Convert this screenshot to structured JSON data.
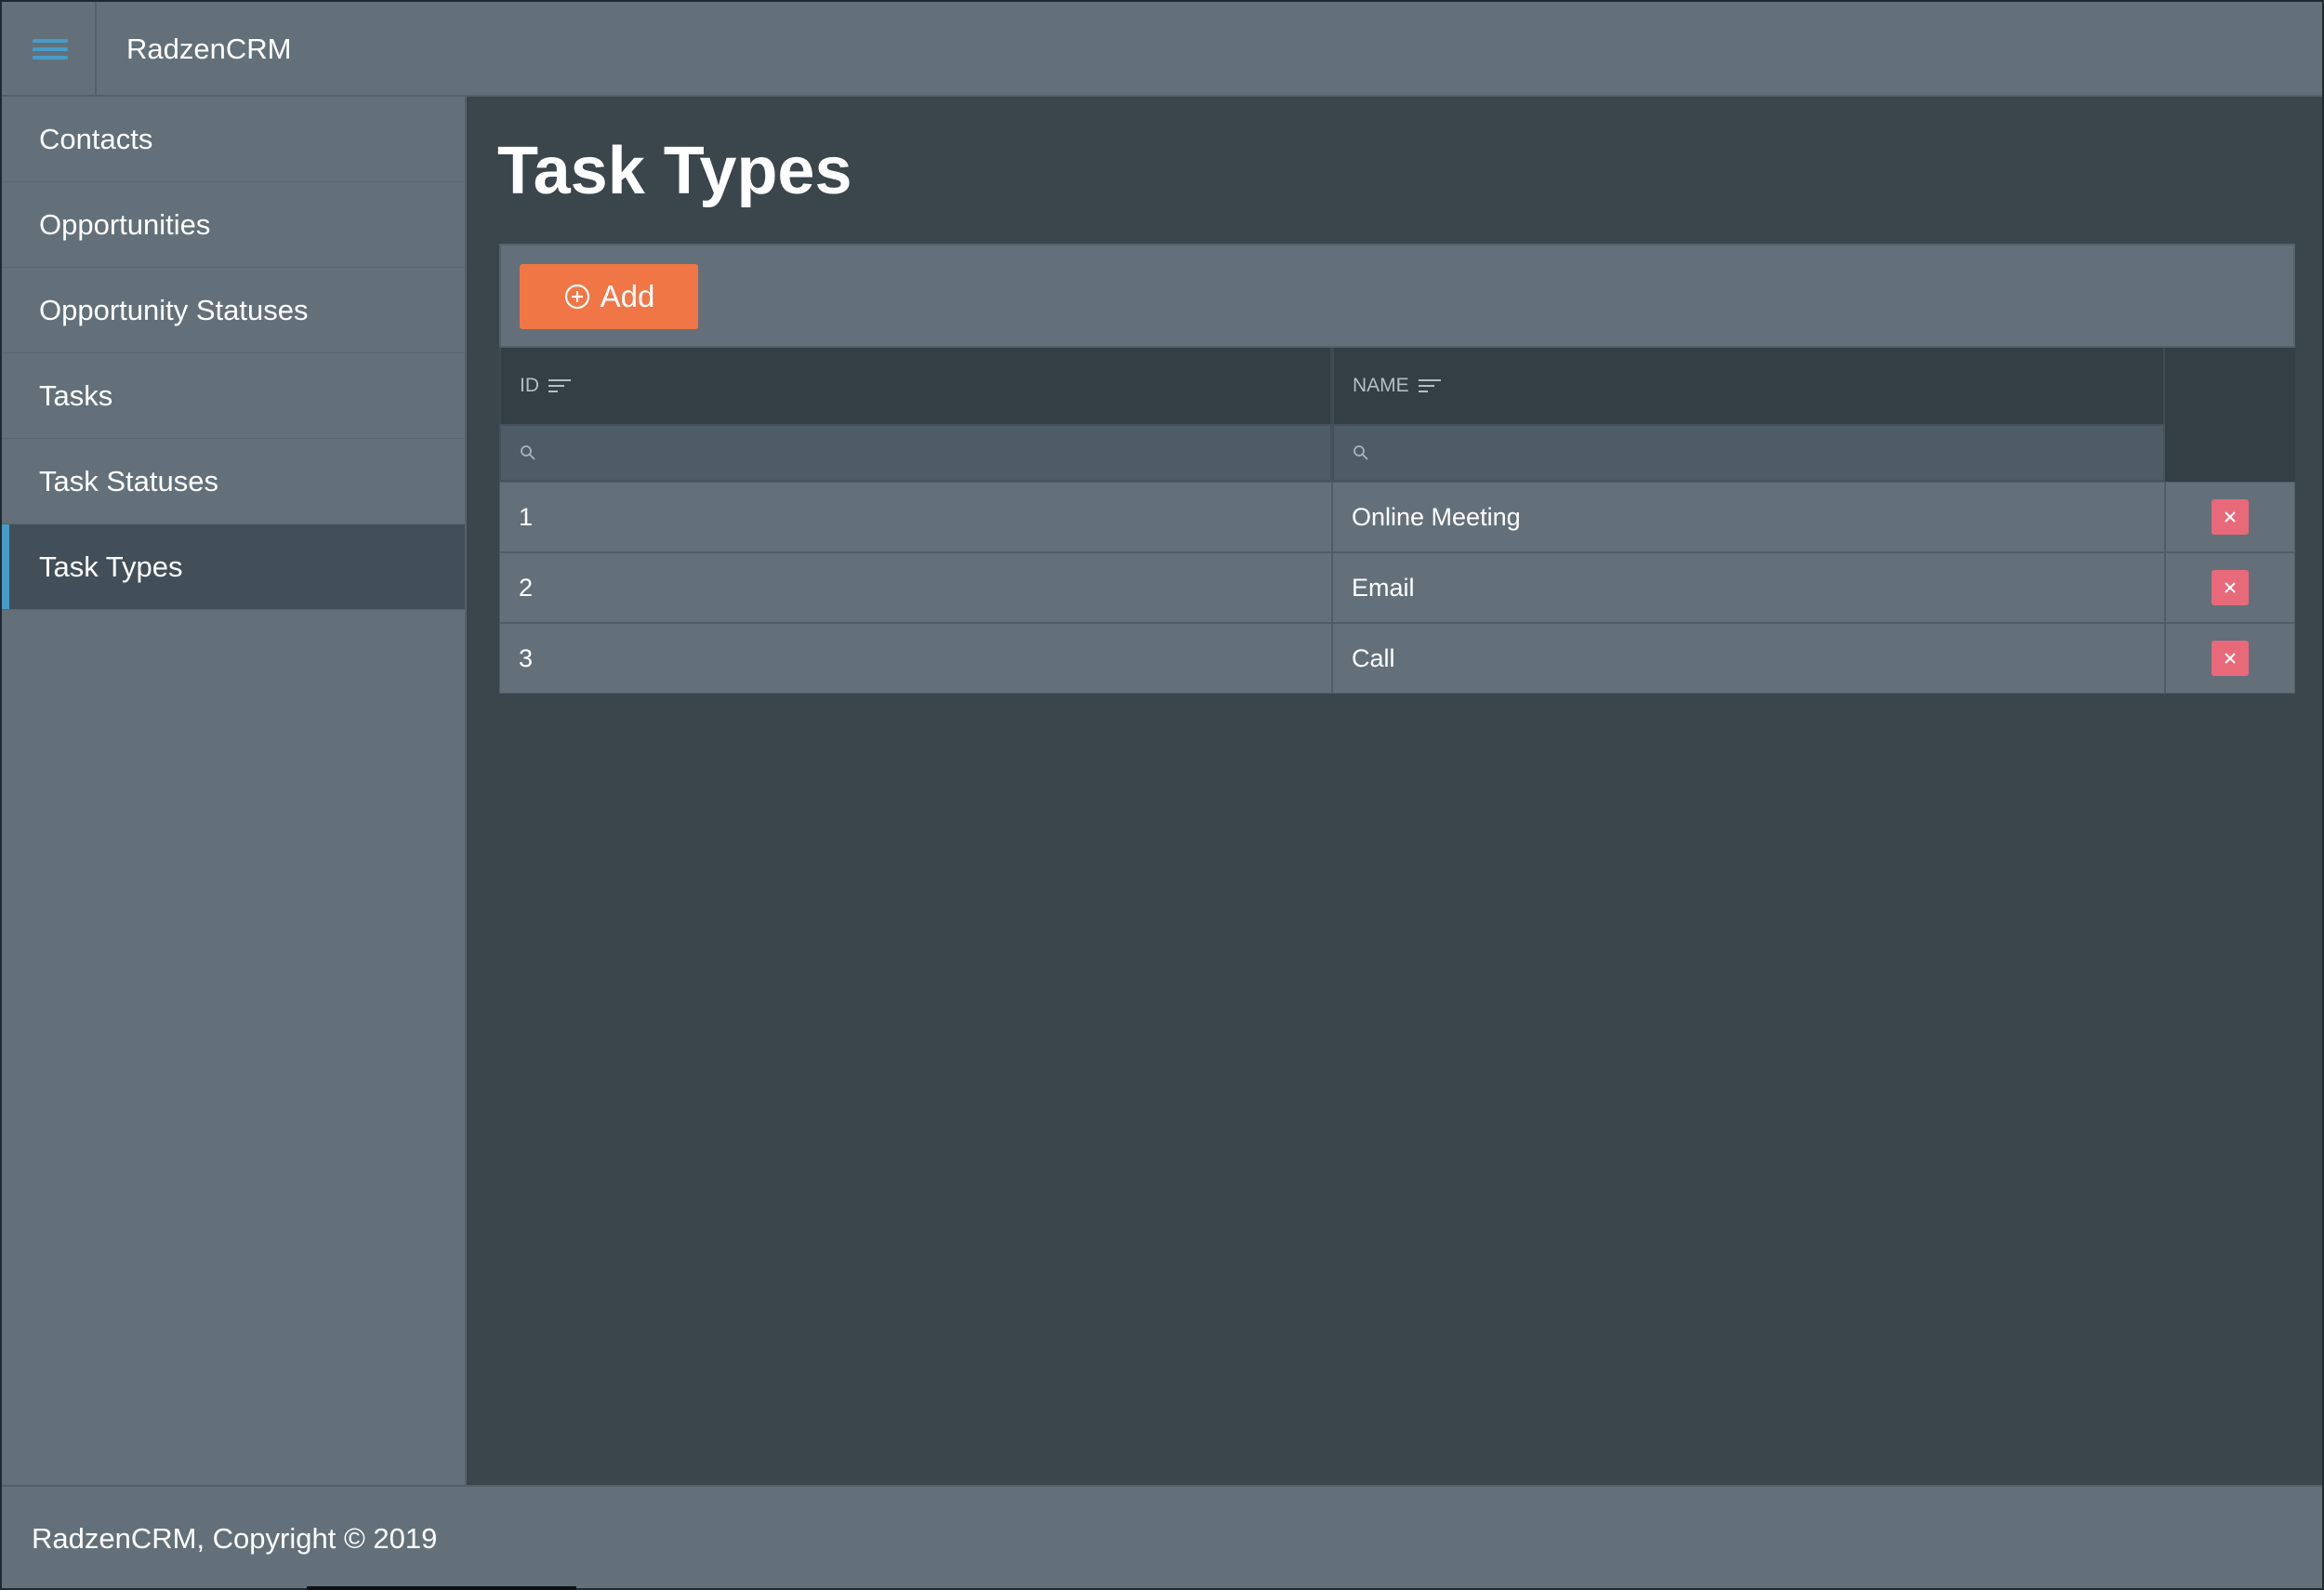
{
  "header": {
    "app_title": "RadzenCRM"
  },
  "sidebar": {
    "items": [
      {
        "label": "Contacts"
      },
      {
        "label": "Opportunities"
      },
      {
        "label": "Opportunity Statuses"
      },
      {
        "label": "Tasks"
      },
      {
        "label": "Task Statuses"
      },
      {
        "label": "Task Types",
        "active": true
      }
    ]
  },
  "main": {
    "page_title": "Task Types",
    "add_label": "Add",
    "columns": {
      "id": "ID",
      "name": "NAME"
    },
    "rows": [
      {
        "id": "1",
        "name": "Online Meeting"
      },
      {
        "id": "2",
        "name": "Email"
      },
      {
        "id": "3",
        "name": "Call"
      }
    ]
  },
  "footer": {
    "text": "RadzenCRM, Copyright © 2019"
  },
  "colors": {
    "accent": "#479cc8",
    "add_button": "#f07646",
    "delete_button": "#e8697a"
  },
  "icons": {
    "menu": "hamburger-menu-icon",
    "add": "plus-circle-icon",
    "sort": "sort-icon",
    "filter": "search-icon",
    "delete": "close-icon"
  }
}
